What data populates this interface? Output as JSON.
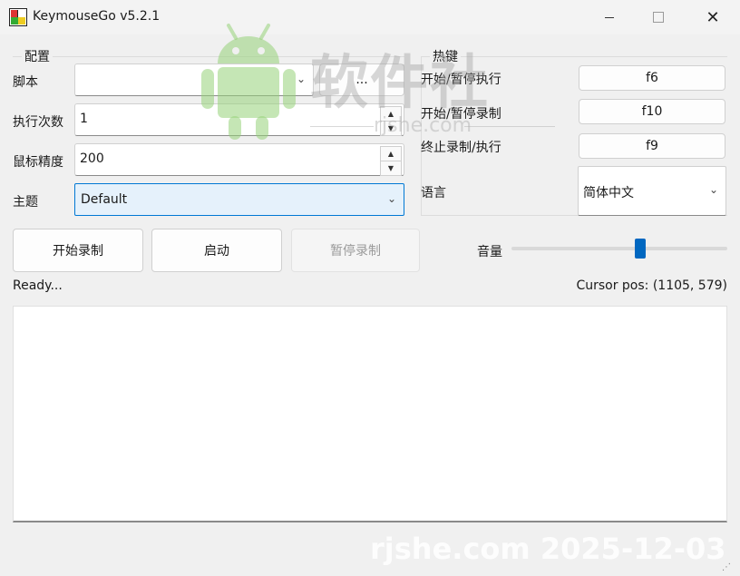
{
  "window": {
    "title": "KeymouseGo v5.2.1",
    "close_glyph": "✕"
  },
  "config": {
    "legend": "配置",
    "script_label": "脚本",
    "script_value": "",
    "browse_label": "...",
    "repeat_label": "执行次数",
    "repeat_value": "1",
    "precision_label": "鼠标精度",
    "precision_value": "200",
    "theme_label": "主题",
    "theme_value": "Default"
  },
  "hotkeys": {
    "legend": "热键",
    "start_pause_exec_label": "开始/暂停执行",
    "start_pause_exec_key": "f6",
    "start_pause_record_label": "开始/暂停录制",
    "start_pause_record_key": "f10",
    "stop_label": "终止录制/执行",
    "stop_key": "f9",
    "language_label": "语言",
    "language_value": "简体中文"
  },
  "actions": {
    "start_record": "开始录制",
    "launch": "启动",
    "pause_record": "暂停录制",
    "volume_label": "音量",
    "volume_level": 0.6
  },
  "status": {
    "text": "Ready...",
    "cursor": "Cursor pos: (1105, 579)"
  },
  "log": {
    "content": ""
  },
  "watermark": {
    "main": "软件社",
    "sub": "rjshe.com",
    "footer": "rjshe.com 2025-12-03"
  },
  "icons": {
    "app": "app-icon",
    "android": "android-icon",
    "chevron": "chevron-down-icon",
    "spin_up": "arrow-up-icon",
    "spin_down": "arrow-down-icon"
  },
  "colors": {
    "accent": "#0067c0",
    "focus_border": "#0078d4",
    "focus_fill": "#e5f1fb"
  }
}
